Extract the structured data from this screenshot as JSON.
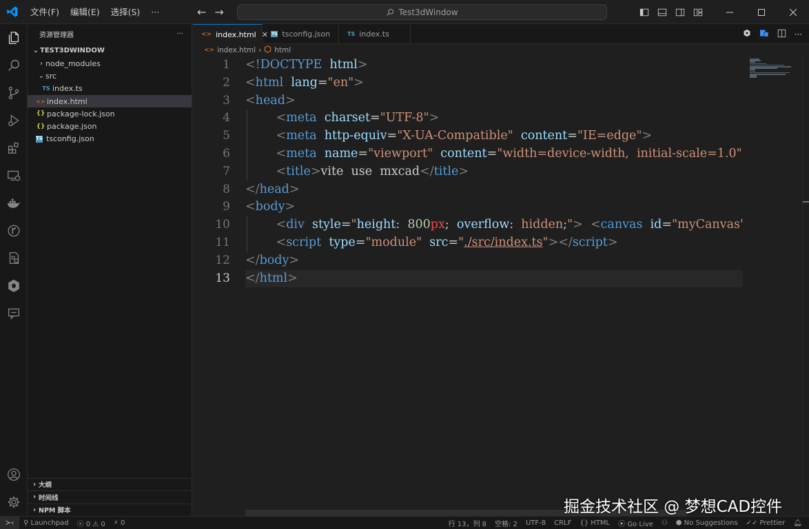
{
  "titlebar": {
    "menu": [
      "文件(F)",
      "编辑(E)",
      "选择(S)",
      "···"
    ],
    "search": "Test3dWindow"
  },
  "sidebar": {
    "title": "资源管理器",
    "more": "···",
    "root": "TEST3DWINDOW",
    "items": [
      {
        "label": "node_modules",
        "icon": "›",
        "type": "folder"
      },
      {
        "label": "src",
        "icon": "⌄",
        "type": "folder"
      },
      {
        "label": "index.ts",
        "icon": "TS",
        "type": "ts"
      },
      {
        "label": "index.html",
        "icon": "<>",
        "type": "html"
      },
      {
        "label": "package-lock.json",
        "icon": "{}",
        "type": "json"
      },
      {
        "label": "package.json",
        "icon": "{}",
        "type": "json"
      },
      {
        "label": "tsconfig.json",
        "icon": "TS",
        "type": "tsconfig"
      }
    ],
    "sections": [
      "大纲",
      "时间线",
      "NPM 脚本"
    ]
  },
  "tabs": [
    {
      "label": "index.html",
      "icon": "<>"
    },
    {
      "label": "tsconfig.json",
      "icon": "TS"
    },
    {
      "label": "index.ts",
      "icon": "TS"
    }
  ],
  "breadcrumb": [
    "index.html",
    "html"
  ],
  "editor": {
    "line_numbers": [
      "1",
      "2",
      "3",
      "4",
      "5",
      "6",
      "7",
      "8",
      "9",
      "10",
      "11",
      "12",
      "13"
    ],
    "current_line": "13"
  },
  "watermark": "掘金技术社区 @ 梦想CAD控件",
  "status": {
    "launchpad": "Launchpad",
    "problems": "0 ⚠ 0",
    "ports": "0",
    "position": "行 13，列 8",
    "spaces": "空格: 2",
    "encoding": "UTF-8",
    "eol": "CRLF",
    "language": "HTML",
    "golive": "Go Live",
    "suggestions": "No Suggestions",
    "prettier": "Prettier"
  },
  "colors": {
    "accent": "#0078d4",
    "html_icon": "#e37933",
    "json_icon": "#cbcb41",
    "ts_icon": "#519aba"
  }
}
